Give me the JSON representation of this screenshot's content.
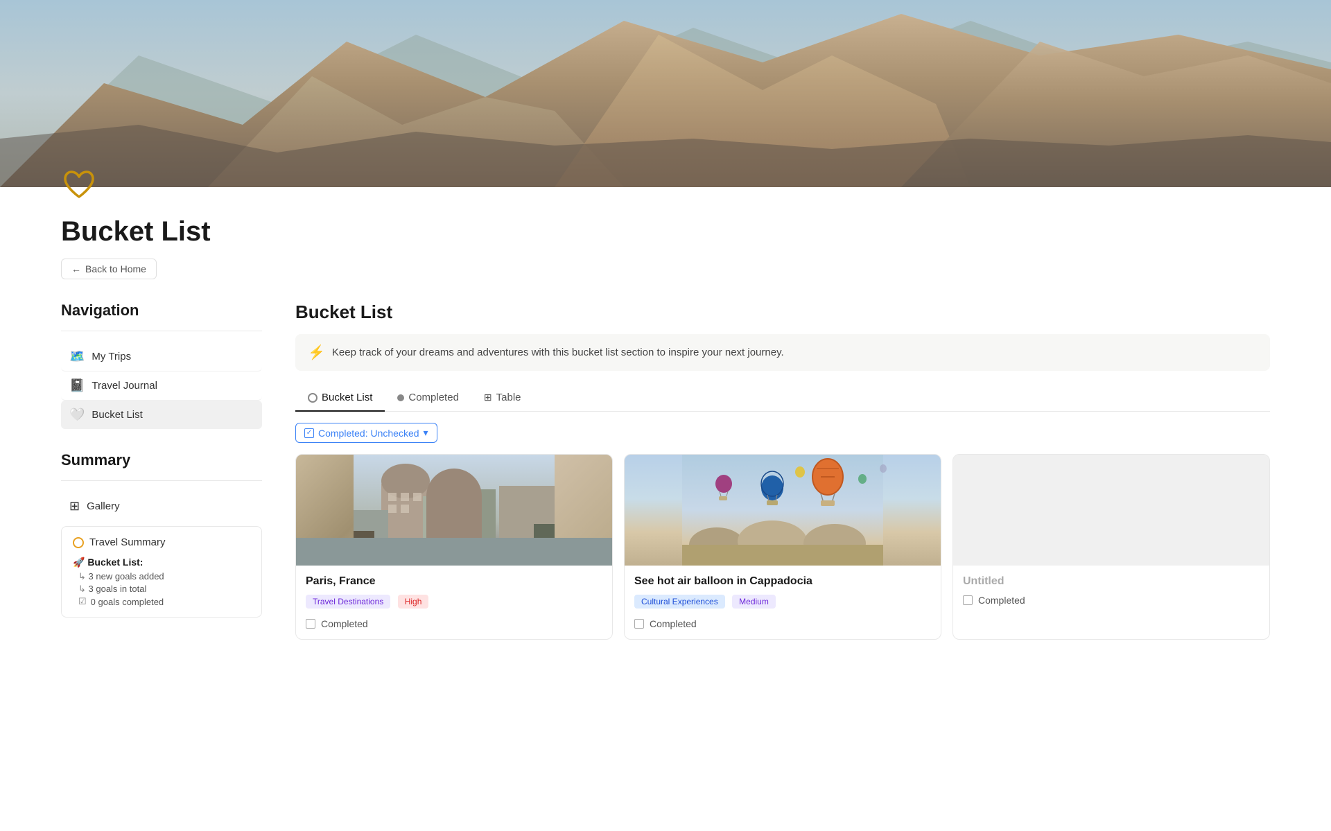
{
  "page": {
    "icon": "🤍",
    "title": "Bucket List",
    "back_label": "Back to Home"
  },
  "sidebar": {
    "navigation_title": "Navigation",
    "nav_items": [
      {
        "icon": "🗺️",
        "label": "My Trips",
        "active": false
      },
      {
        "icon": "📓",
        "label": "Travel Journal",
        "active": false
      },
      {
        "icon": "🤍",
        "label": "Bucket List",
        "active": true
      }
    ],
    "summary_title": "Summary",
    "summary_items": [
      {
        "icon": "⊞",
        "label": "Gallery"
      }
    ],
    "travel_summary": {
      "title": "Travel Summary",
      "bucket_list_label": "🚀 Bucket List:",
      "stats": [
        "3 new goals added",
        "3 goals in total",
        "0 goals completed"
      ]
    }
  },
  "content": {
    "title": "Bucket List",
    "info_text": "Keep track of your dreams and adventures with this bucket list section to inspire your next journey.",
    "tabs": [
      {
        "label": "Bucket List",
        "type": "circle",
        "active": true
      },
      {
        "label": "Completed",
        "type": "dot",
        "active": false
      },
      {
        "label": "Table",
        "type": "table",
        "active": false
      }
    ],
    "filter": "Completed: Unchecked",
    "cards": [
      {
        "title": "Paris, France",
        "image_type": "paris",
        "tags": [
          {
            "label": "Travel Destinations",
            "color": "purple"
          },
          {
            "label": "High",
            "color": "red"
          }
        ],
        "checkbox_label": "Completed"
      },
      {
        "title": "See hot air balloon in Cappadocia",
        "image_type": "cappadocia",
        "tags": [
          {
            "label": "Cultural Experiences",
            "color": "blue"
          },
          {
            "label": "Medium",
            "color": "purple"
          }
        ],
        "checkbox_label": "Completed"
      },
      {
        "title": "Untitled",
        "image_type": "untitled",
        "tags": [],
        "checkbox_label": "Completed"
      }
    ]
  }
}
